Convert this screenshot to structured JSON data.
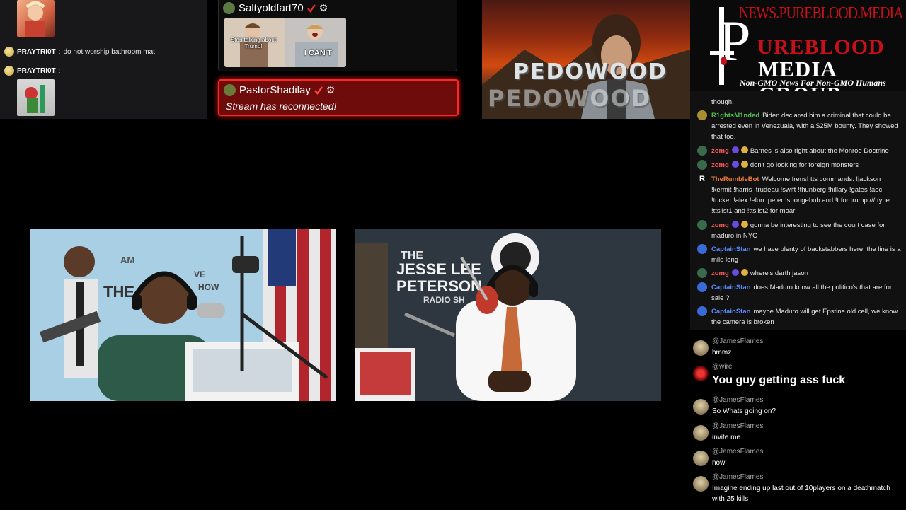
{
  "topleft_chat": {
    "rows": [
      {
        "user": "PRAYTRI0T",
        "sep": ":",
        "msg": "do not worship bathroom mat"
      },
      {
        "user": "PRAYTRI0T",
        "sep": ":",
        "msg": ""
      }
    ]
  },
  "alerts": {
    "first": {
      "user": "Saltyoldfart70",
      "meme_caption_1": "Stop talking about Trump!",
      "meme_caption_2": "I CAN'T"
    },
    "second": {
      "user": "PastorShadilay",
      "message": "Stream has reconnected!"
    }
  },
  "banner": {
    "text_1": "PEDOWOOD",
    "text_2": "PEDOWOOD"
  },
  "logo": {
    "url": "NEWS.PUREBLOOD.MEDIA",
    "letter_p": "P",
    "line1": "UREBLOOD",
    "line2": "MEDIA GROUP",
    "tagline": "Non-GMO News For Non-GMO Humans"
  },
  "chat": {
    "messages": [
      {
        "user": "",
        "color": "#e6e6e6",
        "text": "though."
      },
      {
        "user": "R1ghtsM1nded",
        "color": "#4fc04f",
        "text": "Biden declared him a criminal that could be arrested even in Venezuala, with a $25M bounty. They showed that too."
      },
      {
        "user": "zomg",
        "color": "#ff5a5a",
        "text": "Barnes is also right about the Monroe Doctrine"
      },
      {
        "user": "zomg",
        "color": "#ff5a5a",
        "text": "don't go looking for foreign monsters"
      },
      {
        "user": "TheRumbleBot",
        "color": "#f07a3a",
        "text": "Welcome frens! tts commands: !jackson !kermit !harris !trudeau !swift !thunberg !hillary !gates !aoc !tucker !alex !elon !peter !spongebob and !t for trump /// type !ttslist1 and !ttslist2 for moar"
      },
      {
        "user": "zomg",
        "color": "#ff5a5a",
        "text": "gonna be interesting to see the court case for maduro in NYC"
      },
      {
        "user": "CaptainStan",
        "color": "#5a8cff",
        "text": "we have plenty of backstabbers here, the line is a mile long"
      },
      {
        "user": "zomg",
        "color": "#ff5a5a",
        "text": "where's darth jason"
      },
      {
        "user": "CaptainStan",
        "color": "#5a8cff",
        "text": "does Maduro know all the politico's that are for sale ?"
      },
      {
        "user": "CaptainStan",
        "color": "#5a8cff",
        "text": "maybe Maduro will get Epstine old cell, we know the camera is broken"
      }
    ]
  },
  "chat2": {
    "messages": [
      {
        "user": "@JamesFlames",
        "text": "hmmz"
      },
      {
        "user": "@wire",
        "text": "You guy getting ass fuck"
      },
      {
        "user": "@JamesFlames",
        "text": "So Whats going on?"
      },
      {
        "user": "@JamesFlames",
        "text": "invite me"
      },
      {
        "user": "@JamesFlames",
        "text": "now"
      },
      {
        "user": "@JamesFlames",
        "text": "Imagine ending up last out of 10players on a deathmatch with 25 kills"
      }
    ]
  },
  "video1": {
    "sign_top": "AM",
    "sign_mid": "THE",
    "sign_right": "VE",
    "sign_bottom": "HOW"
  },
  "video2": {
    "sign_1": "THE",
    "sign_2": "JESSE LEE",
    "sign_3": "PETERSON",
    "sign_4": "RADIO SH"
  },
  "colors": {
    "accent_red": "#c8101a",
    "alert_border": "#ff2626"
  }
}
